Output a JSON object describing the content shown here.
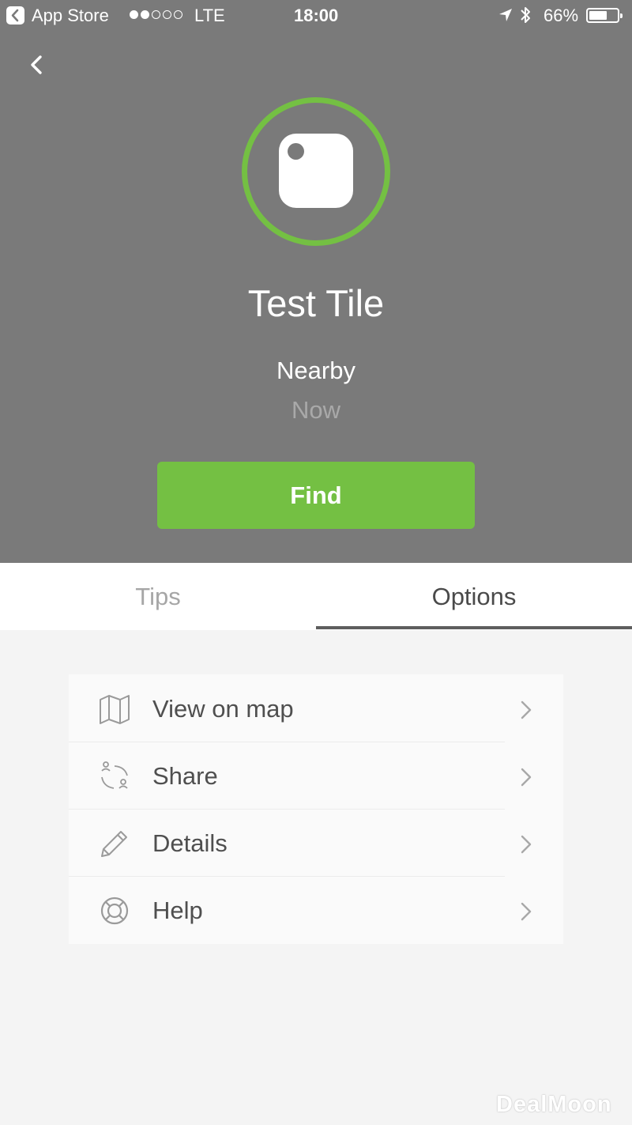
{
  "status_bar": {
    "back_app": "App Store",
    "carrier": "LTE",
    "time": "18:00",
    "battery": "66%",
    "battery_level": 0.66,
    "signal_bars_filled": 2,
    "signal_bars_total": 5
  },
  "device": {
    "name": "Test Tile",
    "status": "Nearby",
    "last_seen": "Now",
    "ring_color": "#74c043",
    "icon": "tile-device-icon"
  },
  "actions": {
    "find_label": "Find",
    "back_icon": "chevron-left-icon"
  },
  "tabs": [
    {
      "label": "Tips",
      "active": false
    },
    {
      "label": "Options",
      "active": true
    }
  ],
  "options": [
    {
      "label": "View on map",
      "icon": "map-icon"
    },
    {
      "label": "Share",
      "icon": "share-users-icon"
    },
    {
      "label": "Details",
      "icon": "pencil-icon"
    },
    {
      "label": "Help",
      "icon": "lifebuoy-icon"
    }
  ],
  "watermark": "DealMoon",
  "colors": {
    "accent": "#74c043",
    "header_bg": "#7a7a7a",
    "page_bg": "#f4f4f4"
  }
}
